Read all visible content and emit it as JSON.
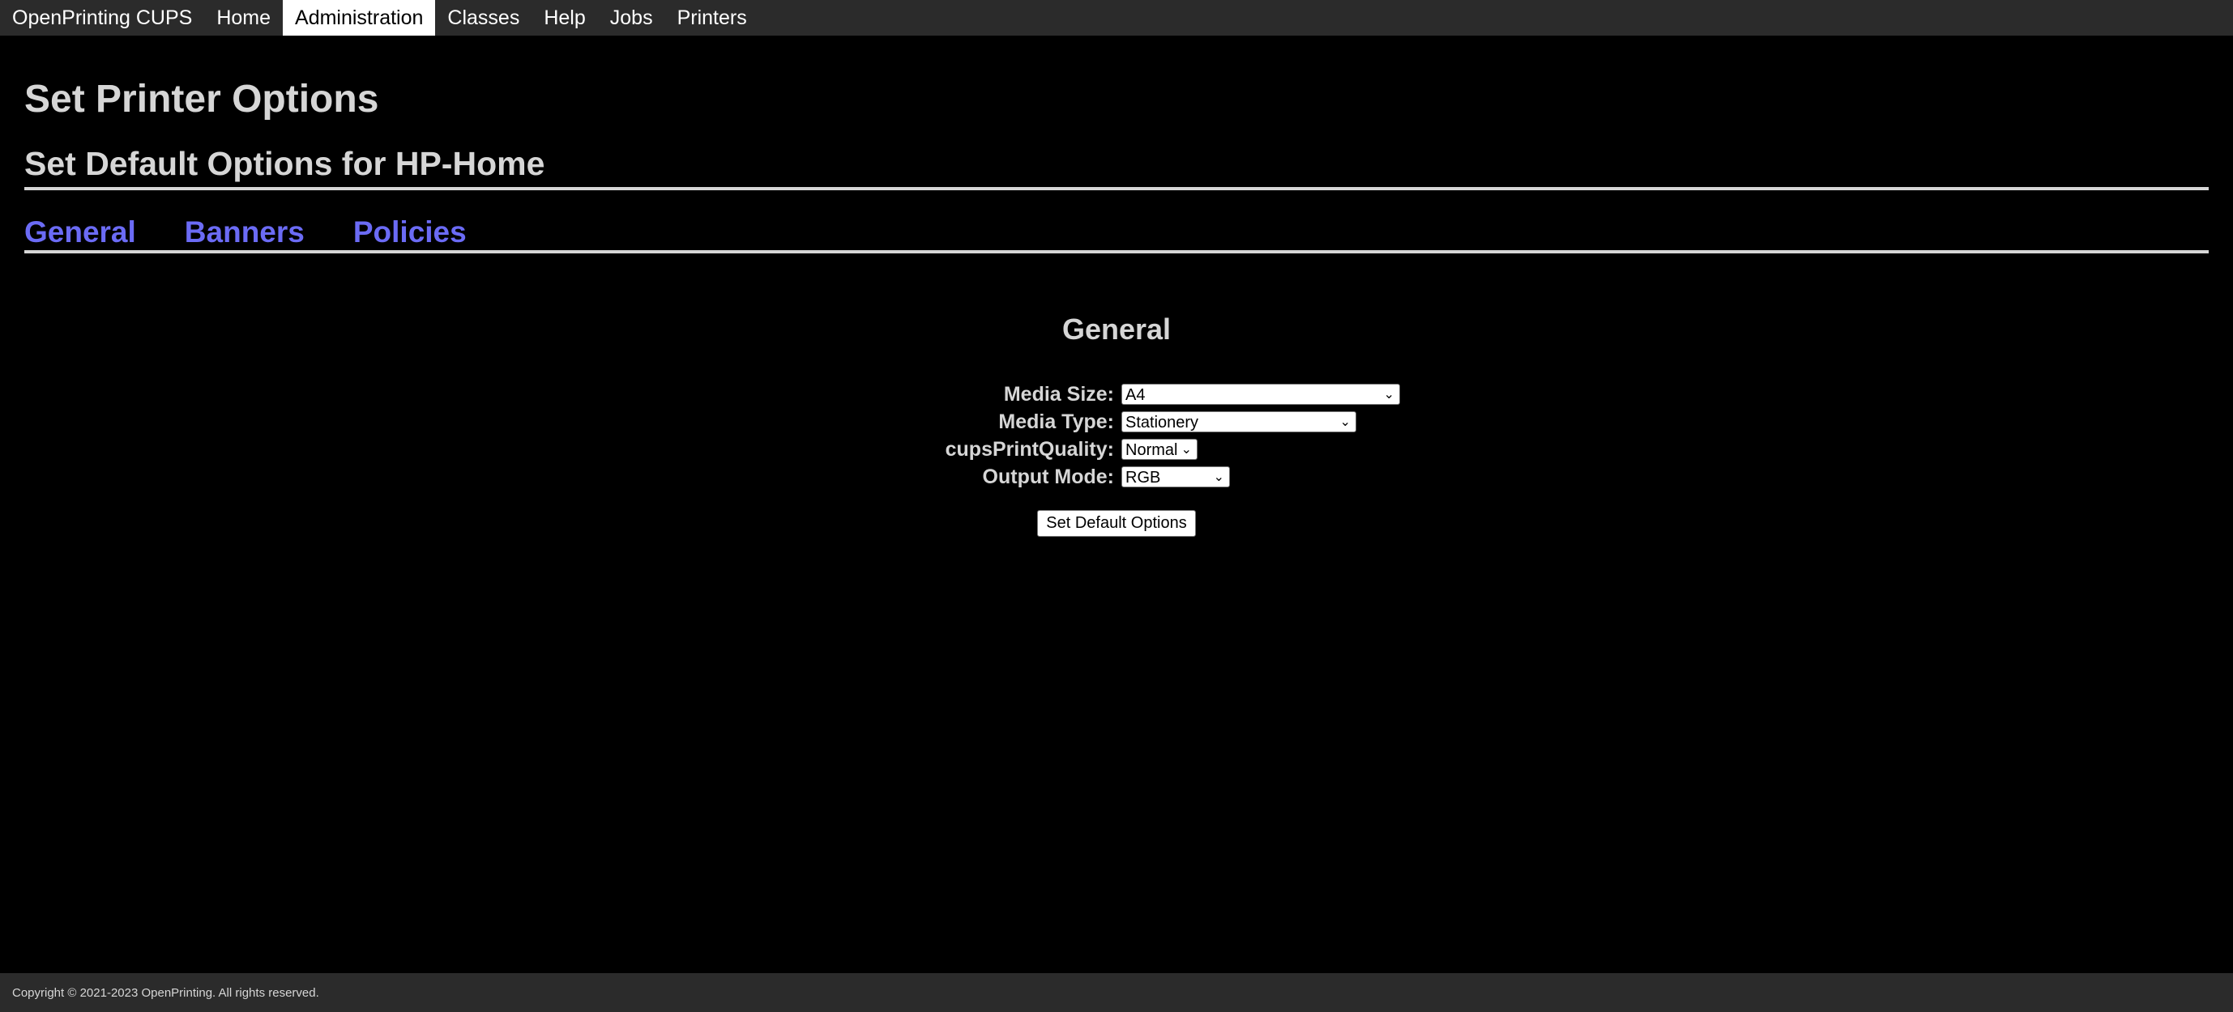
{
  "nav": {
    "brand": "OpenPrinting CUPS",
    "items": [
      {
        "label": "Home"
      },
      {
        "label": "Administration",
        "active": true
      },
      {
        "label": "Classes"
      },
      {
        "label": "Help"
      },
      {
        "label": "Jobs"
      },
      {
        "label": "Printers"
      }
    ]
  },
  "page": {
    "title": "Set Printer Options",
    "subtitle": "Set Default Options for HP-Home"
  },
  "tabs": [
    {
      "label": "General"
    },
    {
      "label": "Banners"
    },
    {
      "label": "Policies"
    }
  ],
  "section": {
    "title": "General"
  },
  "options": [
    {
      "label": "Media Size:",
      "value": "A4"
    },
    {
      "label": "Media Type:",
      "value": "Stationery"
    },
    {
      "label": "cupsPrintQuality:",
      "value": "Normal"
    },
    {
      "label": "Output Mode:",
      "value": "RGB"
    }
  ],
  "submit_label": "Set Default Options",
  "footer": {
    "copyright": "Copyright © 2021-2023 OpenPrinting. All rights reserved."
  },
  "colors": {
    "background": "#000000",
    "nav": "#2b2b2b",
    "link": "#6b6bf5",
    "text": "#d6d6d6"
  }
}
